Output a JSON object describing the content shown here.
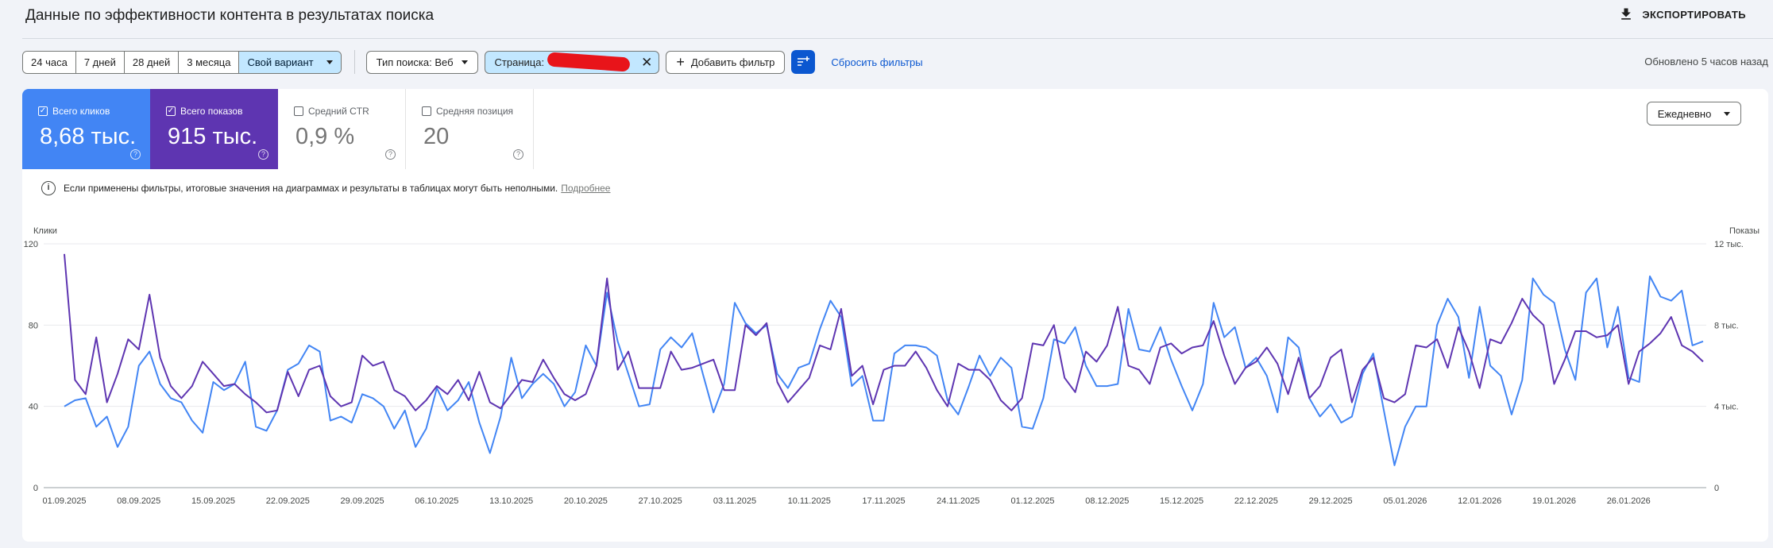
{
  "header": {
    "title": "Данные по эффективности контента в результатах поиска",
    "export_label": "ЭКСПОРТИРОВАТЬ",
    "export_icon": "download-icon"
  },
  "filters": {
    "date_ranges": [
      "24 часа",
      "7 дней",
      "28 дней",
      "3 месяца",
      "Свой вариант"
    ],
    "date_active": "Свой вариант",
    "search_type": "Тип поиска: Веб",
    "page_label": "Страница:",
    "add_filter": "Добавить фильтр",
    "reset": "Сбросить фильтры",
    "updated": "Обновлено 5 часов назад"
  },
  "metrics": {
    "clicks": {
      "label": "Всего кликов",
      "value": "8,68 тыс.",
      "checked": true,
      "color": "#4285f4"
    },
    "impressions": {
      "label": "Всего показов",
      "value": "915 тыс.",
      "checked": true,
      "color": "#5e35b1"
    },
    "ctr": {
      "label": "Средний CTR",
      "value": "0,9 %",
      "checked": false
    },
    "position": {
      "label": "Средняя позиция",
      "value": "20",
      "checked": false
    }
  },
  "period": "Ежедневно",
  "notice": {
    "text": "Если применены фильтры, итоговые значения на диаграммах и результаты в таблицах могут быть неполными.",
    "link": "Подробнее"
  },
  "chart_data": {
    "type": "line",
    "ylabel_left": "Клики",
    "ylabel_right": "Показы",
    "y_left_ticks": [
      "0",
      "40",
      "80",
      "120"
    ],
    "y_right_ticks": [
      "0",
      "4 тыс.",
      "8 тыс.",
      "12 тыс."
    ],
    "ylim_left": [
      0,
      120
    ],
    "ylim_right": [
      0,
      12000
    ],
    "x_tick_labels": [
      "01.09.2025",
      "08.09.2025",
      "15.09.2025",
      "22.09.2025",
      "29.09.2025",
      "06.10.2025",
      "13.10.2025",
      "20.10.2025",
      "27.10.2025",
      "03.11.2025",
      "10.11.2025",
      "17.11.2025",
      "24.11.2025",
      "01.12.2025",
      "08.12.2025",
      "15.12.2025",
      "22.12.2025",
      "29.12.2025",
      "05.01.2026",
      "12.01.2026",
      "19.01.2026",
      "26.01.2026"
    ],
    "x_start": "01.09.2025",
    "x_end": "31.01.2026",
    "grid": true,
    "series": [
      {
        "name": "Всего кликов",
        "color": "#4285f4",
        "axis": "left",
        "values": [
          40,
          43,
          44,
          30,
          35,
          20,
          30,
          60,
          67,
          51,
          44,
          42,
          33,
          27,
          52,
          48,
          51,
          62,
          30,
          28,
          38,
          58,
          61,
          70,
          67,
          33,
          35,
          32,
          46,
          44,
          40,
          29,
          38,
          20,
          29,
          49,
          38,
          43,
          52,
          32,
          17,
          35,
          64,
          44,
          51,
          56,
          51,
          40,
          47,
          70,
          60,
          96,
          72,
          56,
          40,
          41,
          68,
          74,
          69,
          76,
          56,
          37,
          51,
          91,
          81,
          76,
          80,
          56,
          49,
          59,
          61,
          78,
          92,
          84,
          50,
          55,
          33,
          33,
          66,
          70,
          70,
          69,
          65,
          43,
          36,
          50,
          65,
          55,
          64,
          59,
          30,
          29,
          44,
          73,
          71,
          79,
          60,
          50,
          50,
          51,
          88,
          68,
          67,
          79,
          63,
          50,
          38,
          51,
          91,
          74,
          79,
          59,
          64,
          55,
          37,
          74,
          69,
          44,
          35,
          41,
          32,
          35,
          56,
          66,
          38,
          11,
          30,
          40,
          40,
          80,
          93,
          84,
          54,
          89,
          60,
          55,
          36,
          53,
          103,
          95,
          91,
          68,
          53,
          96,
          103,
          69,
          89,
          54,
          52,
          104,
          94,
          92,
          97,
          70,
          72
        ]
      },
      {
        "name": "Всего показов",
        "color": "#5e35b1",
        "axis": "right",
        "values": [
          11500,
          5300,
          4600,
          7400,
          4200,
          5600,
          7300,
          6800,
          9500,
          6400,
          5000,
          4400,
          5000,
          6200,
          5600,
          5000,
          5100,
          4600,
          4200,
          3700,
          3800,
          5700,
          4500,
          5800,
          6000,
          4500,
          4000,
          4200,
          6500,
          6000,
          6200,
          4800,
          4500,
          3800,
          4300,
          5000,
          4600,
          5300,
          4300,
          5700,
          4200,
          3900,
          4600,
          5300,
          5200,
          6300,
          5400,
          4600,
          4300,
          4600,
          6000,
          10300,
          5800,
          6700,
          4900,
          4900,
          4900,
          6700,
          5800,
          5900,
          6100,
          6300,
          4800,
          4800,
          8000,
          7500,
          8100,
          5200,
          4200,
          4800,
          5400,
          7000,
          6800,
          8800,
          5500,
          6000,
          4100,
          5800,
          6000,
          6000,
          6700,
          5900,
          4800,
          4000,
          6100,
          5800,
          5800,
          5300,
          4300,
          3800,
          4400,
          7100,
          7000,
          8000,
          5400,
          4700,
          6700,
          6200,
          7000,
          8900,
          6000,
          5800,
          5100,
          6900,
          7100,
          6600,
          6900,
          7000,
          8200,
          6500,
          5100,
          5900,
          6200,
          6900,
          6100,
          4600,
          6400,
          4400,
          5000,
          6400,
          6800,
          4200,
          5800,
          6400,
          4400,
          4200,
          4600,
          7000,
          6900,
          7300,
          5900,
          7900,
          6700,
          4900,
          7300,
          7100,
          8100,
          9300,
          8500,
          8000,
          5100,
          6300,
          7700,
          7700,
          7400,
          7500,
          8000,
          5100,
          6700,
          7100,
          7600,
          8400,
          7000,
          6700,
          6200
        ]
      }
    ]
  }
}
